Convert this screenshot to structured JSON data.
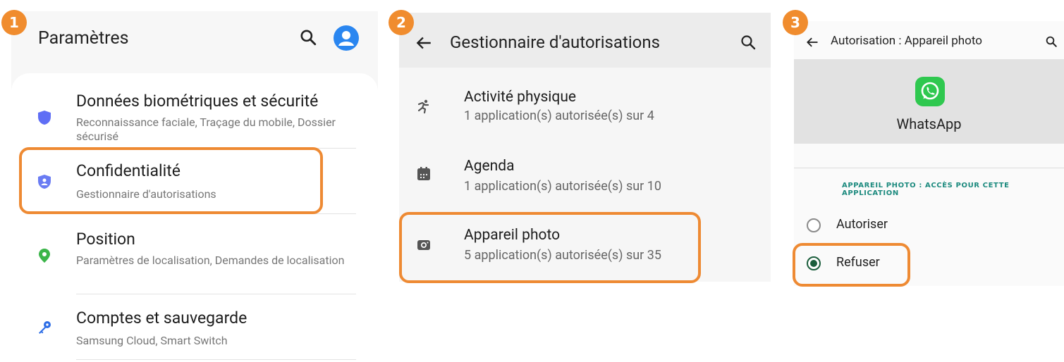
{
  "steps": [
    "1",
    "2",
    "3"
  ],
  "colors": {
    "highlight": "#ee8a33",
    "badge": "#f08c2e",
    "accent_teal": "#1c8a7e"
  },
  "settings": {
    "title": "Paramètres",
    "search_icon": "search-icon",
    "avatar_icon": "account-avatar-icon",
    "items": [
      {
        "icon": "shield-icon",
        "title": "Données biométriques et sécurité",
        "subtitle": "Reconnaissance faciale, Traçage du mobile, Dossier sécurisé"
      },
      {
        "icon": "privacy-shield-icon",
        "title": "Confidentialité",
        "subtitle": "Gestionnaire d'autorisations"
      },
      {
        "icon": "location-pin-icon",
        "title": "Position",
        "subtitle": "Paramètres de localisation, Demandes de localisation"
      },
      {
        "icon": "key-icon",
        "title": "Comptes et sauvegarde",
        "subtitle": "Samsung Cloud, Smart Switch"
      }
    ]
  },
  "permissions": {
    "title": "Gestionnaire d'autorisations",
    "items": [
      {
        "icon": "physical-activity-icon",
        "title": "Activité physique",
        "subtitle": "1 application(s) autorisée(s) sur 4"
      },
      {
        "icon": "calendar-icon",
        "title": "Agenda",
        "subtitle": "1 application(s) autorisée(s) sur 10"
      },
      {
        "icon": "camera-icon",
        "title": "Appareil photo",
        "subtitle": "5 application(s) autorisée(s) sur 35"
      }
    ]
  },
  "camera_permission": {
    "title": "Autorisation : Appareil photo",
    "app_name": "WhatsApp",
    "app_icon": "whatsapp-icon",
    "section_label": "APPAREIL PHOTO : ACCÈS POUR CETTE APPLICATION",
    "options": [
      {
        "label": "Autoriser",
        "selected": false
      },
      {
        "label": "Refuser",
        "selected": true
      }
    ]
  }
}
